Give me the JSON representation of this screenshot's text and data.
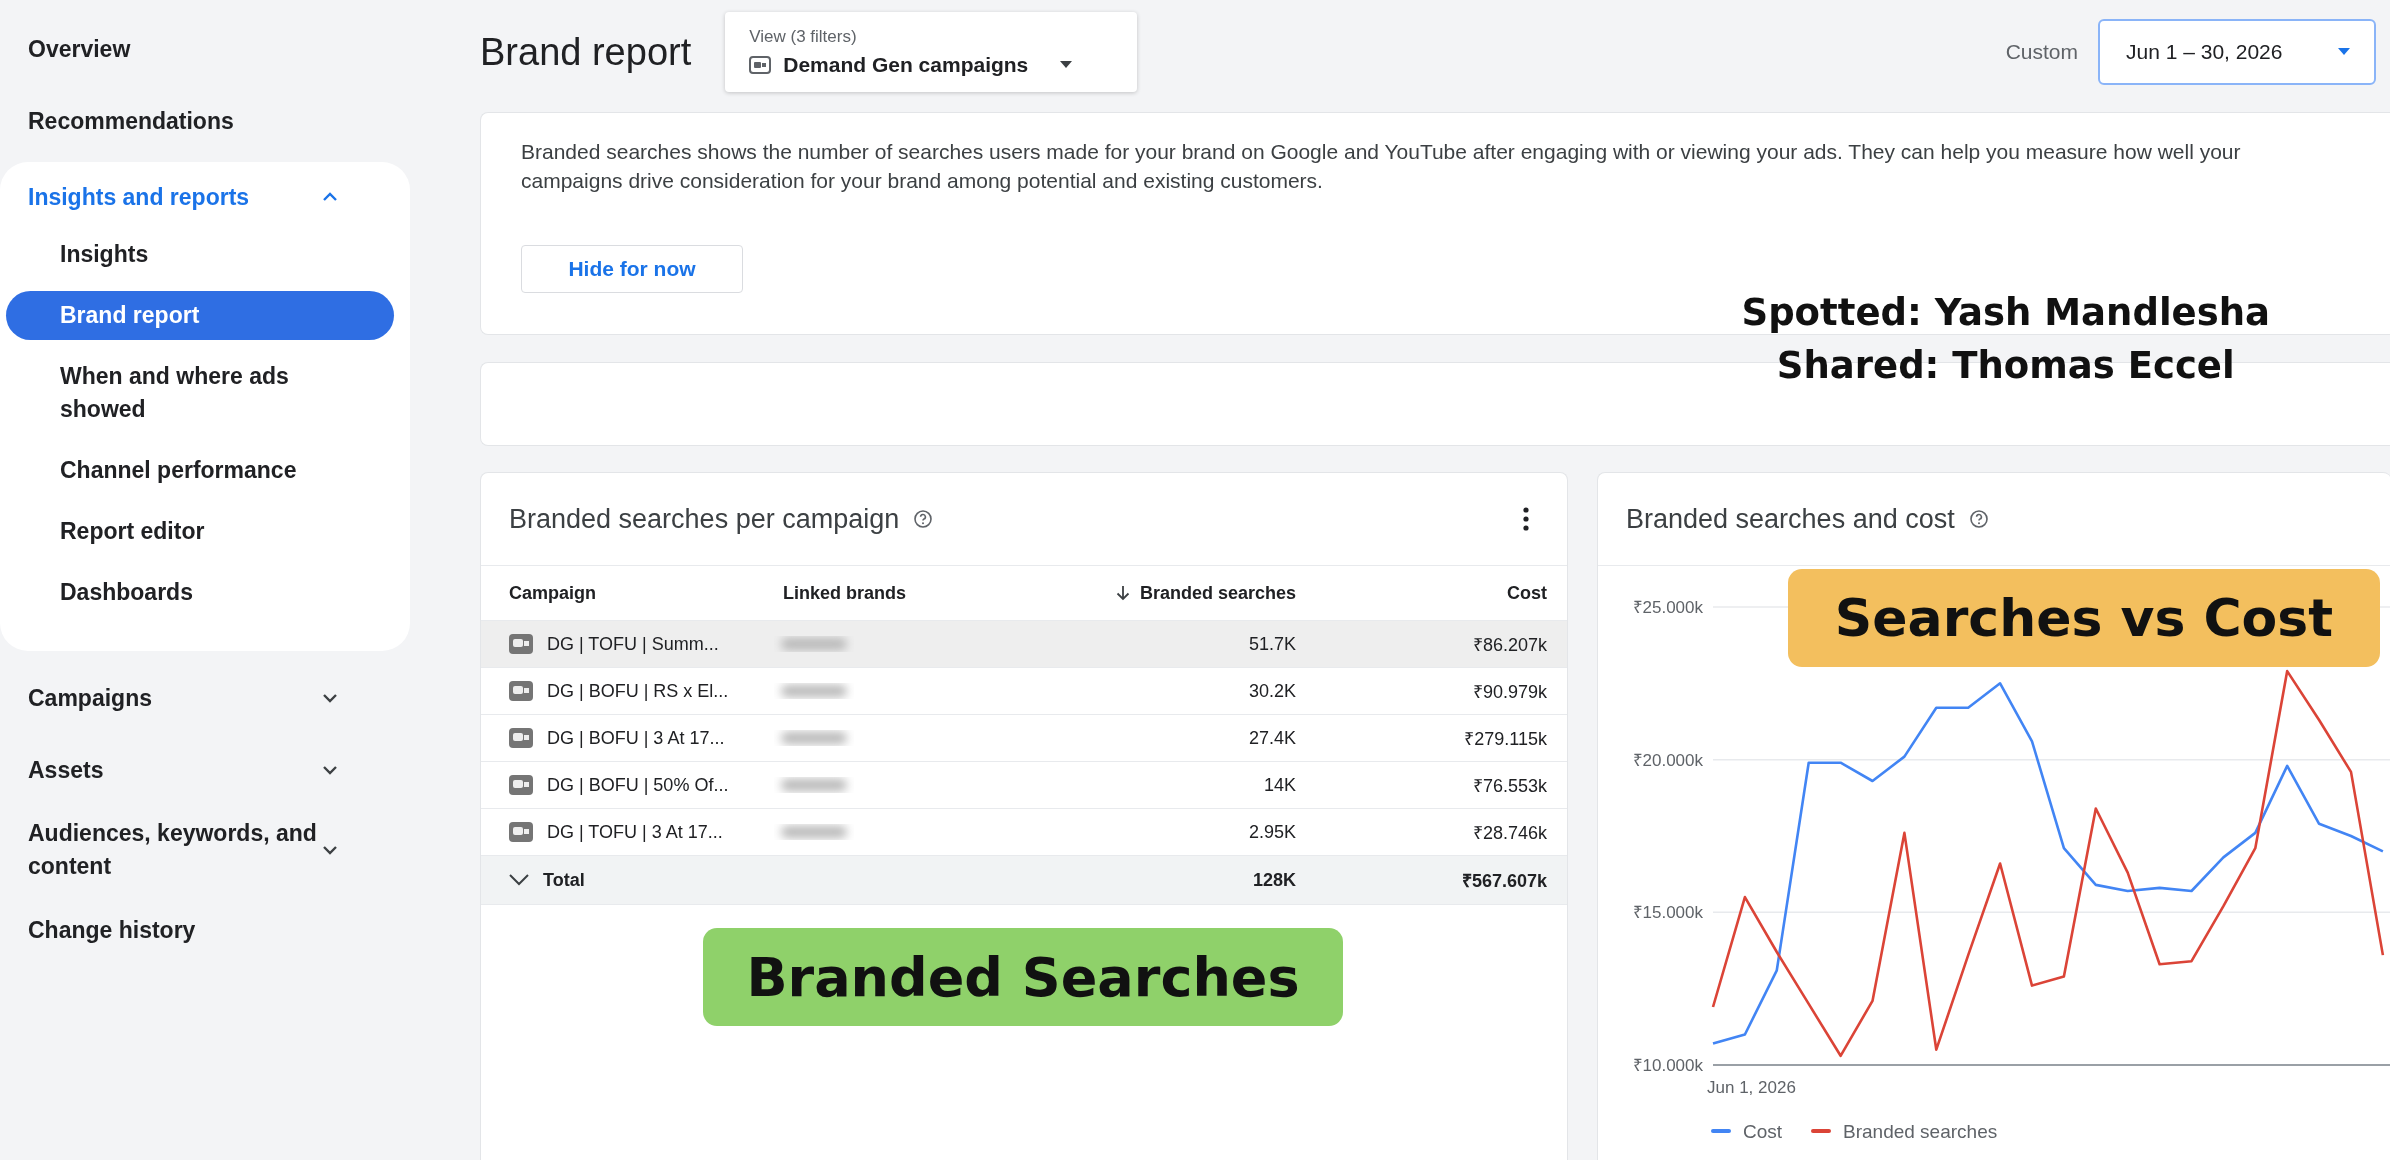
{
  "sidebar": {
    "items": [
      {
        "label": "Overview",
        "selected": false
      },
      {
        "label": "Recommendations",
        "selected": false
      },
      {
        "label": "Insights and reports",
        "expanded": true,
        "children": [
          {
            "label": "Insights",
            "selected": false
          },
          {
            "label": "Brand report",
            "selected": true
          },
          {
            "label": "When and where ads showed",
            "selected": false
          },
          {
            "label": "Channel performance",
            "selected": false
          },
          {
            "label": "Report editor",
            "selected": false
          },
          {
            "label": "Dashboards",
            "selected": false
          }
        ]
      },
      {
        "label": "Campaigns",
        "selected": false,
        "expanded": false
      },
      {
        "label": "Assets",
        "selected": false,
        "expanded": false
      },
      {
        "label": "Audiences, keywords, and content",
        "selected": false,
        "expanded": false
      },
      {
        "label": "Change history",
        "selected": false
      }
    ]
  },
  "header": {
    "title": "Brand report",
    "view_filter": {
      "label": "View (3 filters)",
      "value": "Demand Gen campaigns"
    },
    "date_range": {
      "label": "Custom",
      "value": "Jun 1 – 30, 2026"
    }
  },
  "banner": {
    "text": "Branded searches shows the number of searches users made for your brand on Google and YouTube after engaging with or viewing your ads. They can help you measure how well your campaigns drive consideration for your brand among potential and existing customers.",
    "button": "Hide for now",
    "captions": [
      "Spotted: Yash Mandlesha",
      "Shared: Thomas Eccel"
    ]
  },
  "table_card": {
    "title": "Branded searches per campaign",
    "overlay_label": {
      "text": "Branded Searches",
      "color": "#8fd16a"
    },
    "table": {
      "columns": [
        {
          "label": "Campaign",
          "sorted": false
        },
        {
          "label": "Linked brands",
          "sorted": false
        },
        {
          "label": "Branded searches",
          "sorted": true
        },
        {
          "label": "Cost",
          "sorted": false
        }
      ],
      "rows": [
        {
          "campaign": "DG | TOFU | Summ...",
          "branded_searches": "51.7K",
          "cost": "₹86.207k",
          "highlighted": true
        },
        {
          "campaign": "DG | BOFU | RS x El...",
          "branded_searches": "30.2K",
          "cost": "₹90.979k",
          "highlighted": false
        },
        {
          "campaign": "DG | BOFU | 3 At 17...",
          "branded_searches": "27.4K",
          "cost": "₹279.115k",
          "highlighted": false
        },
        {
          "campaign": "DG | BOFU | 50% Of...",
          "branded_searches": "14K",
          "cost": "₹76.553k",
          "highlighted": false
        },
        {
          "campaign": "DG | TOFU | 3 At 17...",
          "branded_searches": "2.95K",
          "cost": "₹28.746k",
          "highlighted": false
        }
      ],
      "total": {
        "label": "Total",
        "branded_searches": "128K",
        "cost": "₹567.607k"
      }
    }
  },
  "chart_card": {
    "title": "Branded searches and cost",
    "start_date_label": "Jun 1, 2026",
    "overlay_label": {
      "text": "Searches vs Cost",
      "color": "#f3bf5e"
    },
    "chart_data": {
      "type": "line",
      "legend": "bottom",
      "ylim": [
        10000,
        25000
      ],
      "yticks": [
        {
          "value": 10000,
          "label": "₹10.000k"
        },
        {
          "value": 15000,
          "label": "₹15.000k"
        },
        {
          "value": 20000,
          "label": "₹20.000k"
        },
        {
          "value": 25000,
          "label": "₹25.000k"
        }
      ],
      "series": [
        {
          "name": "Cost",
          "color": "#4285f4",
          "values": [
            10700,
            11000,
            13100,
            19900,
            19900,
            19300,
            20100,
            21700,
            21700,
            22500,
            20600,
            17100,
            15900,
            15700,
            15800,
            15700,
            16800,
            17600,
            19800,
            17900,
            17500,
            17000
          ]
        },
        {
          "name": "Branded searches",
          "color": "#db4437",
          "values": [
            11900,
            15500,
            13700,
            12000,
            10300,
            12100,
            17600,
            10500,
            13600,
            16600,
            12600,
            12900,
            18400,
            16300,
            13300,
            13400,
            15200,
            17100,
            22900,
            21300,
            19600,
            13600
          ]
        }
      ]
    }
  }
}
